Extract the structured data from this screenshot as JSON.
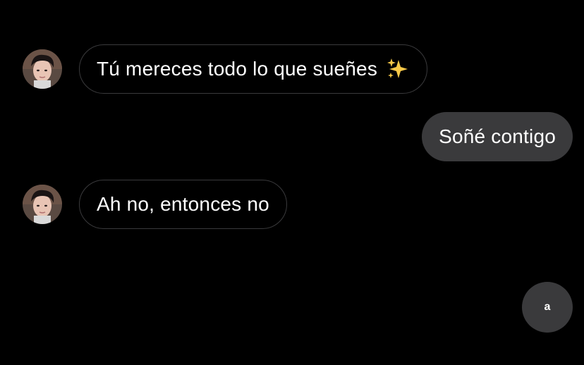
{
  "conversation": {
    "messages": [
      {
        "direction": "received",
        "text": "Tú mereces todo lo que sueñes",
        "emoji": "sparkles-icon"
      },
      {
        "direction": "sent",
        "text": "Soñé contigo"
      },
      {
        "direction": "received",
        "text": "Ah no, entonces no"
      }
    ]
  },
  "floating_button": {
    "label": "a"
  },
  "colors": {
    "background": "#000000",
    "sent_bubble": "#3a3a3c",
    "received_border": "#3a3a3c",
    "text": "#ffffff",
    "sparkles": "#f7c948"
  }
}
